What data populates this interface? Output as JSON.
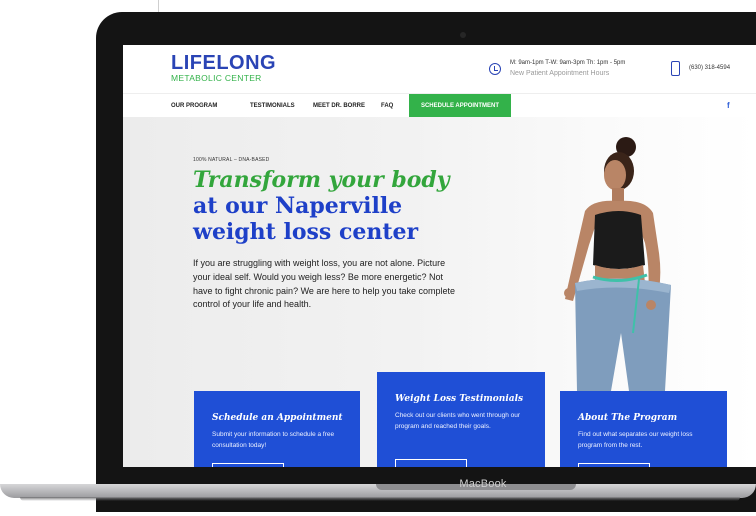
{
  "device": {
    "label": "MacBook"
  },
  "site": {
    "logo": {
      "main": "LIFELONG",
      "sub": "METABOLIC CENTER"
    },
    "hours": {
      "line1": "M: 9am-1pm T-W: 9am-3pm Th: 1pm - 5pm",
      "line2": "New Patient Appointment Hours"
    },
    "phone": "(630) 318-4594",
    "nav": {
      "items": [
        "OUR PROGRAM",
        "TESTIMONIALS",
        "MEET DR. BORRE",
        "FAQ"
      ],
      "cta": "SCHEDULE APPOINTMENT",
      "social": "f"
    },
    "hero": {
      "eyebrow": "100% NATURAL – DNA-BASED",
      "headline_green": "Transform your body",
      "headline_blue_1": "at our Naperville",
      "headline_blue_2": "weight loss center",
      "body": "If you are struggling with weight loss, you are not alone. Picture your ideal self. Would you weigh less? Be more energetic? Not have to fight chronic pain? We are here to help you take complete control of your life and health."
    },
    "cards": [
      {
        "title": "Schedule an Appointment",
        "text": "Submit your information to schedule a free consultation today!"
      },
      {
        "title": "Weight Loss Testimonials",
        "text": "Check out our clients who went through our program and reached their goals."
      },
      {
        "title": "About The Program",
        "text": "Find out what separates our weight loss program from the rest."
      }
    ]
  },
  "colors": {
    "brand_blue": "#1e40c8",
    "brand_green": "#33b24a",
    "card_blue": "#1f4fd6"
  }
}
